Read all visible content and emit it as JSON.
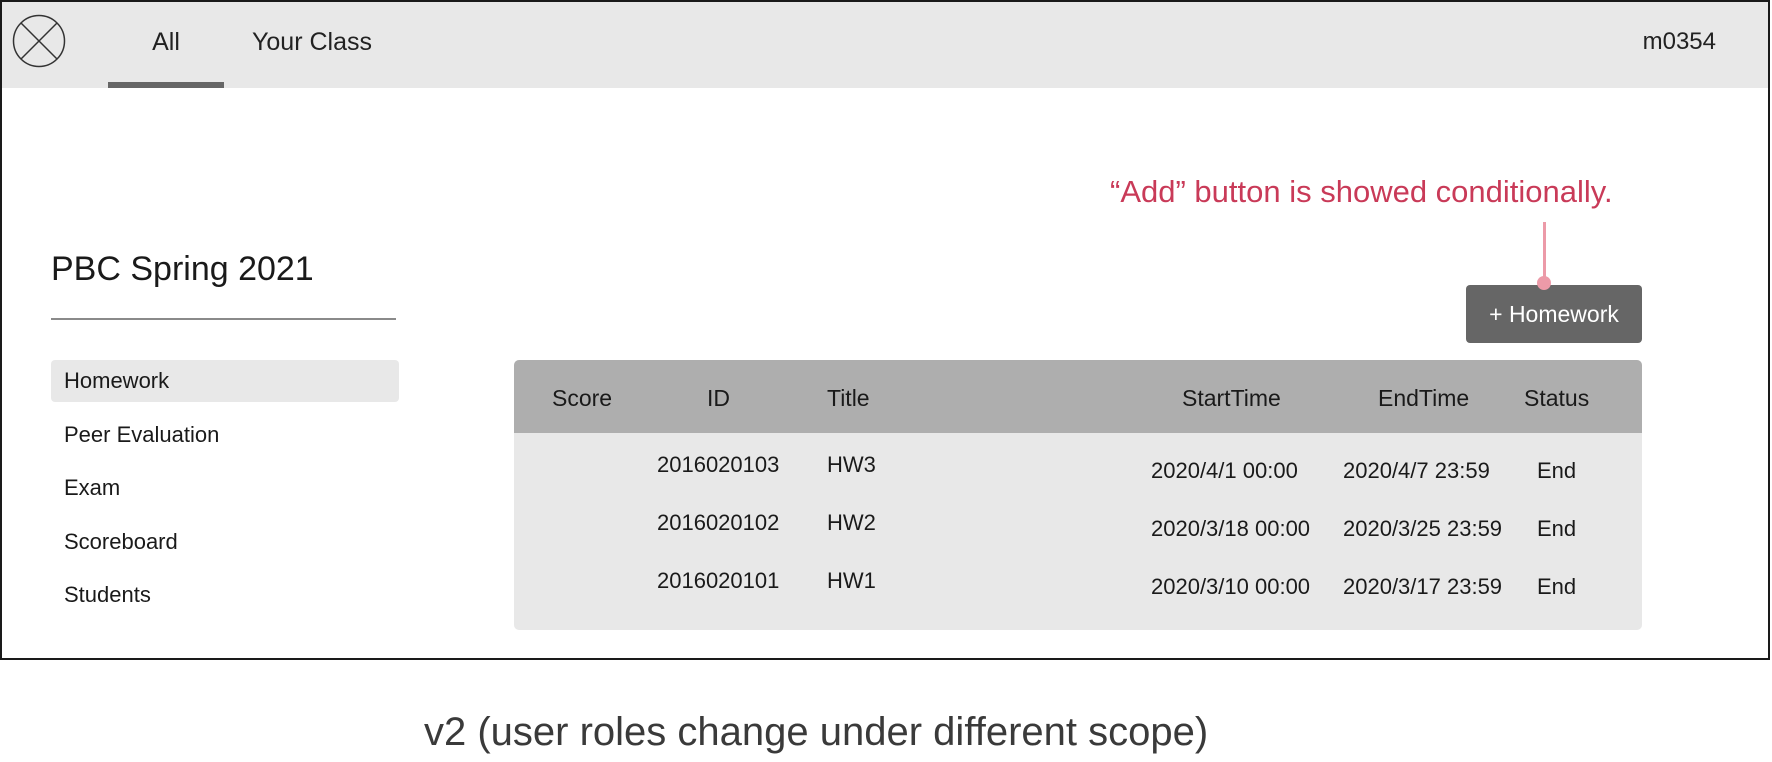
{
  "topbar": {
    "tabs": [
      {
        "label": "All",
        "active": true
      },
      {
        "label": "Your Class",
        "active": false
      }
    ],
    "user": "m0354",
    "logo_icon": "placeholder-x-circle-icon"
  },
  "course": {
    "title": "PBC Spring 2021"
  },
  "sidebar": {
    "items": [
      {
        "label": "Homework",
        "active": true
      },
      {
        "label": "Peer Evaluation"
      },
      {
        "label": "Exam"
      },
      {
        "label": "Scoreboard"
      },
      {
        "label": "Students"
      }
    ]
  },
  "annotation": {
    "text": "“Add” button is showed conditionally.",
    "color": "#c93a58"
  },
  "toolbar": {
    "add_homework_label": "+ Homework"
  },
  "table": {
    "headers": {
      "score": "Score",
      "id": "ID",
      "title": "Title",
      "start": "StartTime",
      "end": "EndTime",
      "status": "Status"
    },
    "rows": [
      {
        "score": "",
        "id": "2016020103",
        "title": "HW3",
        "start": "2020/4/1 00:00",
        "end": "2020/4/7 23:59",
        "status": "End"
      },
      {
        "score": "",
        "id": "2016020102",
        "title": "HW2",
        "start": "2020/3/18 00:00",
        "end": "2020/3/25 23:59",
        "status": "End"
      },
      {
        "score": "",
        "id": "2016020101",
        "title": "HW1",
        "start": "2020/3/10 00:00",
        "end": "2020/3/17 23:59",
        "status": "End"
      }
    ]
  },
  "caption": "v2 (user roles change under different scope)"
}
